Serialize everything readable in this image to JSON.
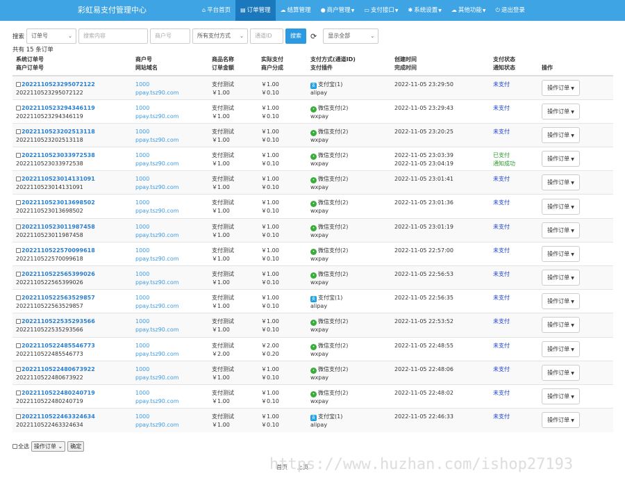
{
  "app": {
    "title": "彩虹易支付管理中心"
  },
  "nav": [
    {
      "label": "平台首页",
      "icon": "home-icon",
      "active": false,
      "caret": false
    },
    {
      "label": "订单管理",
      "icon": "list-icon",
      "active": true,
      "caret": false
    },
    {
      "label": "结算管理",
      "icon": "cloud-icon",
      "active": false,
      "caret": false
    },
    {
      "label": "商户管理",
      "icon": "user-icon",
      "active": false,
      "caret": true
    },
    {
      "label": "支付接口",
      "icon": "card-icon",
      "active": false,
      "caret": true
    },
    {
      "label": "系统设置",
      "icon": "gear-icon",
      "active": false,
      "caret": true
    },
    {
      "label": "其他功能",
      "icon": "cloud-icon",
      "active": false,
      "caret": true
    },
    {
      "label": "退出登录",
      "icon": "power-icon",
      "active": false,
      "caret": false
    }
  ],
  "filter": {
    "label": "搜索",
    "field_select": "订单号",
    "keyword_placeholder": "搜索内容",
    "merchant_placeholder": "商户号",
    "paytype_select": "所有支付方式",
    "channel_placeholder": "通道ID",
    "search_button": "搜索",
    "display_select": "显示全部"
  },
  "count_text": "共有 15 条订单",
  "columns": [
    {
      "l1": "系统订单号",
      "l2": "商户订单号"
    },
    {
      "l1": "商户号",
      "l2": "网站域名"
    },
    {
      "l1": "商品名称",
      "l2": "订单金额"
    },
    {
      "l1": "实际支付",
      "l2": "商户分成"
    },
    {
      "l1": "支付方式(通道ID)",
      "l2": "支付插件"
    },
    {
      "l1": "创建时间",
      "l2": "完成时间"
    },
    {
      "l1": "支付状态",
      "l2": "通知状态"
    },
    {
      "l1": "",
      "l2": "操作"
    }
  ],
  "orders": [
    {
      "trade_no": "2022110523295072122",
      "out_trade_no": "2022110523295072122",
      "uid": "1000",
      "domain": "ppay.tsz90.com",
      "name": "支付测试",
      "money": "￥1.00",
      "realmoney": "￥1.00",
      "getmoney": "￥0.10",
      "paytype": "支付宝(1)",
      "paycls": "ali",
      "plugin": "alipay",
      "addtime": "2022-11-05 23:29:50",
      "endtime": "",
      "status": "未支付",
      "notify": "",
      "stcls": "unpaid",
      "op": "操作订单"
    },
    {
      "trade_no": "2022110523294346119",
      "out_trade_no": "2022110523294346119",
      "uid": "1000",
      "domain": "ppay.tsz90.com",
      "name": "支付测试",
      "money": "￥1.00",
      "realmoney": "￥1.00",
      "getmoney": "￥0.10",
      "paytype": "微信支付(2)",
      "paycls": "wx",
      "plugin": "wxpay",
      "addtime": "2022-11-05 23:29:43",
      "endtime": "",
      "status": "未支付",
      "notify": "",
      "stcls": "unpaid",
      "op": "操作订单"
    },
    {
      "trade_no": "2022110523202513118",
      "out_trade_no": "2022110523202513118",
      "uid": "1000",
      "domain": "ppay.tsz90.com",
      "name": "支付测试",
      "money": "￥1.00",
      "realmoney": "￥1.00",
      "getmoney": "￥0.10",
      "paytype": "微信支付(2)",
      "paycls": "wx",
      "plugin": "wxpay",
      "addtime": "2022-11-05 23:20:25",
      "endtime": "",
      "status": "未支付",
      "notify": "",
      "stcls": "unpaid",
      "op": "操作订单"
    },
    {
      "trade_no": "2022110523033972538",
      "out_trade_no": "2022110523033972538",
      "uid": "1000",
      "domain": "ppay.tsz90.com",
      "name": "支付测试",
      "money": "￥1.00",
      "realmoney": "￥1.00",
      "getmoney": "￥0.10",
      "paytype": "微信支付(2)",
      "paycls": "wx",
      "plugin": "wxpay",
      "addtime": "2022-11-05 23:03:39",
      "endtime": "2022-11-05 23:04:19",
      "status": "已支付",
      "notify": "通知成功",
      "stcls": "paid",
      "op": "操作订单"
    },
    {
      "trade_no": "2022110523014131091",
      "out_trade_no": "2022110523014131091",
      "uid": "1000",
      "domain": "ppay.tsz90.com",
      "name": "支付测试",
      "money": "￥1.00",
      "realmoney": "￥1.00",
      "getmoney": "￥0.10",
      "paytype": "微信支付(2)",
      "paycls": "wx",
      "plugin": "wxpay",
      "addtime": "2022-11-05 23:01:41",
      "endtime": "",
      "status": "未支付",
      "notify": "",
      "stcls": "unpaid",
      "op": "操作订单"
    },
    {
      "trade_no": "2022110523013698502",
      "out_trade_no": "2022110523013698502",
      "uid": "1000",
      "domain": "ppay.tsz90.com",
      "name": "支付测试",
      "money": "￥1.00",
      "realmoney": "￥1.00",
      "getmoney": "￥0.10",
      "paytype": "微信支付(2)",
      "paycls": "wx",
      "plugin": "wxpay",
      "addtime": "2022-11-05 23:01:36",
      "endtime": "",
      "status": "未支付",
      "notify": "",
      "stcls": "unpaid",
      "op": "操作订单"
    },
    {
      "trade_no": "2022110523011987458",
      "out_trade_no": "2022110523011987458",
      "uid": "1000",
      "domain": "ppay.tsz90.com",
      "name": "支付测试",
      "money": "￥1.00",
      "realmoney": "￥1.00",
      "getmoney": "￥0.10",
      "paytype": "微信支付(2)",
      "paycls": "wx",
      "plugin": "wxpay",
      "addtime": "2022-11-05 23:01:19",
      "endtime": "",
      "status": "未支付",
      "notify": "",
      "stcls": "unpaid",
      "op": "操作订单"
    },
    {
      "trade_no": "2022110522570099618",
      "out_trade_no": "2022110522570099618",
      "uid": "1000",
      "domain": "ppay.tsz90.com",
      "name": "支付测试",
      "money": "￥1.00",
      "realmoney": "￥1.00",
      "getmoney": "￥0.10",
      "paytype": "微信支付(2)",
      "paycls": "wx",
      "plugin": "wxpay",
      "addtime": "2022-11-05 22:57:00",
      "endtime": "",
      "status": "未支付",
      "notify": "",
      "stcls": "unpaid",
      "op": "操作订单"
    },
    {
      "trade_no": "2022110522565399026",
      "out_trade_no": "2022110522565399026",
      "uid": "1000",
      "domain": "ppay.tsz90.com",
      "name": "支付测试",
      "money": "￥1.00",
      "realmoney": "￥1.00",
      "getmoney": "￥0.10",
      "paytype": "微信支付(2)",
      "paycls": "wx",
      "plugin": "wxpay",
      "addtime": "2022-11-05 22:56:53",
      "endtime": "",
      "status": "未支付",
      "notify": "",
      "stcls": "unpaid",
      "op": "操作订单"
    },
    {
      "trade_no": "2022110522563529857",
      "out_trade_no": "2022110522563529857",
      "uid": "1000",
      "domain": "ppay.tsz90.com",
      "name": "支付测试",
      "money": "￥1.00",
      "realmoney": "￥1.00",
      "getmoney": "￥0.10",
      "paytype": "支付宝(1)",
      "paycls": "ali",
      "plugin": "alipay",
      "addtime": "2022-11-05 22:56:35",
      "endtime": "",
      "status": "未支付",
      "notify": "",
      "stcls": "unpaid",
      "op": "操作订单"
    },
    {
      "trade_no": "2022110522535293566",
      "out_trade_no": "2022110522535293566",
      "uid": "1000",
      "domain": "ppay.tsz90.com",
      "name": "支付测试",
      "money": "￥1.00",
      "realmoney": "￥1.00",
      "getmoney": "￥0.10",
      "paytype": "微信支付(2)",
      "paycls": "wx",
      "plugin": "wxpay",
      "addtime": "2022-11-05 22:53:52",
      "endtime": "",
      "status": "未支付",
      "notify": "",
      "stcls": "unpaid",
      "op": "操作订单"
    },
    {
      "trade_no": "2022110522485546773",
      "out_trade_no": "2022110522485546773",
      "uid": "1000",
      "domain": "ppay.tsz90.com",
      "name": "支付测试",
      "money": "￥2.00",
      "realmoney": "￥2.00",
      "getmoney": "￥0.20",
      "paytype": "微信支付(2)",
      "paycls": "wx",
      "plugin": "wxpay",
      "addtime": "2022-11-05 22:48:55",
      "endtime": "",
      "status": "未支付",
      "notify": "",
      "stcls": "unpaid",
      "op": "操作订单"
    },
    {
      "trade_no": "2022110522480673922",
      "out_trade_no": "2022110522480673922",
      "uid": "1000",
      "domain": "ppay.tsz90.com",
      "name": "支付测试",
      "money": "￥1.00",
      "realmoney": "￥1.00",
      "getmoney": "￥0.10",
      "paytype": "微信支付(2)",
      "paycls": "wx",
      "plugin": "wxpay",
      "addtime": "2022-11-05 22:48:06",
      "endtime": "",
      "status": "未支付",
      "notify": "",
      "stcls": "unpaid",
      "op": "操作订单"
    },
    {
      "trade_no": "2022110522480240719",
      "out_trade_no": "2022110522480240719",
      "uid": "1000",
      "domain": "ppay.tsz90.com",
      "name": "支付测试",
      "money": "￥1.00",
      "realmoney": "￥1.00",
      "getmoney": "￥0.10",
      "paytype": "微信支付(2)",
      "paycls": "wx",
      "plugin": "wxpay",
      "addtime": "2022-11-05 22:48:02",
      "endtime": "",
      "status": "未支付",
      "notify": "",
      "stcls": "unpaid",
      "op": "操作订单"
    },
    {
      "trade_no": "2022110522463324634",
      "out_trade_no": "2022110522463324634",
      "uid": "1000",
      "domain": "ppay.tsz90.com",
      "name": "支付测试",
      "money": "￥1.00",
      "realmoney": "￥1.00",
      "getmoney": "￥0.10",
      "paytype": "支付宝(1)",
      "paycls": "ali",
      "plugin": "alipay",
      "addtime": "2022-11-05 22:46:33",
      "endtime": "",
      "status": "未支付",
      "notify": "",
      "stcls": "unpaid",
      "op": "操作订单"
    }
  ],
  "bottom": {
    "select_all": "全选",
    "batch_select": "操作订单",
    "confirm": "确定"
  },
  "pager": {
    "first": "首页",
    "prev": "上页"
  },
  "watermark": "https://www.huzhan.com/ishop27193",
  "colors": {
    "navbar": "#3ea4e4",
    "nav_active": "#1b78bd",
    "link": "#2a7fd0",
    "unpaid": "#1a3fd6",
    "paid": "#2c9a2c",
    "alipay": "#1c9de2",
    "wechat": "#38ad3a"
  }
}
